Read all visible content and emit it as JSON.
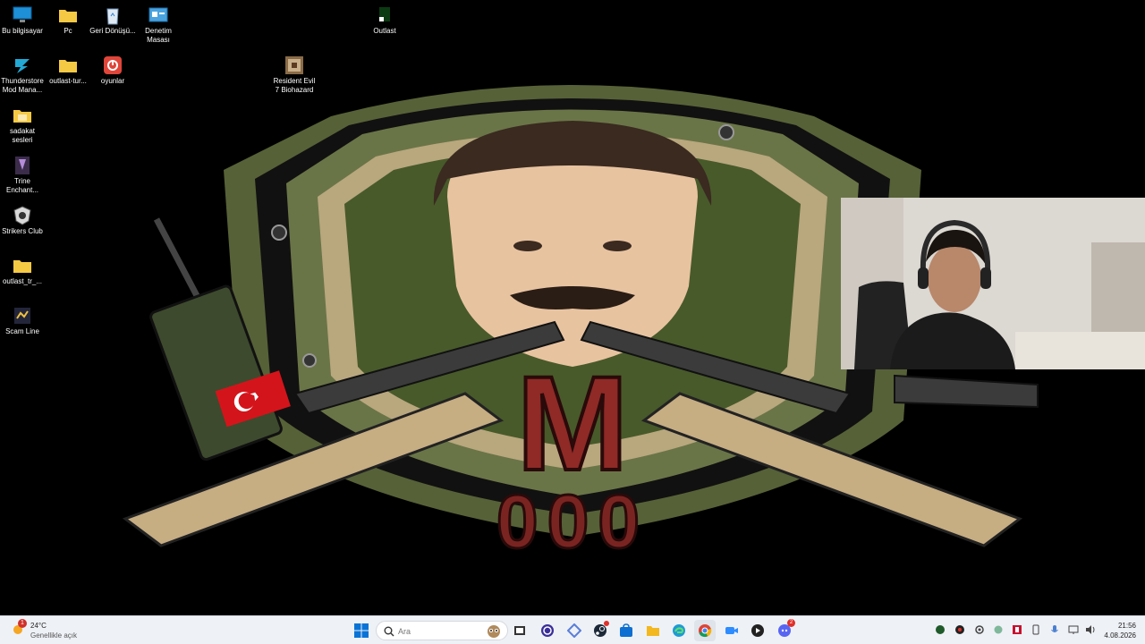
{
  "desktop": {
    "icons": [
      {
        "label": "Bu bilgisayar",
        "icon": "monitor-icon"
      },
      {
        "label": "Pc",
        "icon": "folder-icon"
      },
      {
        "label": "Geri Dönüşü...",
        "icon": "recycle-bin-icon"
      },
      {
        "label": "Denetim Masası",
        "icon": "control-panel-icon"
      },
      {
        "label": "Outlast",
        "icon": "outlast-shortcut-icon"
      },
      {
        "label": "Thunderstore Mod Mana...",
        "icon": "thunderstore-icon"
      },
      {
        "label": "outlast-tur...",
        "icon": "folder-icon"
      },
      {
        "label": "oyunlar",
        "icon": "power-app-icon"
      },
      {
        "label": "Resident Evil 7 Biohazard",
        "icon": "resident-evil-icon"
      },
      {
        "label": "sadakat sesleri",
        "icon": "folder-icon"
      },
      {
        "label": "Trine Enchant...",
        "icon": "trine-icon"
      },
      {
        "label": "Strikers Club",
        "icon": "strikers-club-icon"
      },
      {
        "label": "outlast_tr_...",
        "icon": "folder-icon"
      },
      {
        "label": "Scam Line",
        "icon": "scam-line-icon"
      }
    ]
  },
  "wallpaper": {
    "logo_letter": "M",
    "logo_number": "000",
    "flag": "turkey-flag"
  },
  "taskbar": {
    "weather": {
      "badge": "1",
      "temperature": "24°C",
      "condition": "Genellikle açık"
    },
    "search": {
      "placeholder": "Ara"
    },
    "apps": [
      "windows-start-icon",
      "task-view-icon",
      "browser-circle-icon",
      "diamond-app-icon",
      "steam-icon",
      "store-icon",
      "file-explorer-icon",
      "edge-icon",
      "chrome-icon",
      "zoom-video-icon",
      "media-player-icon",
      "discord-icon"
    ],
    "discord_badge": "2",
    "tray": [
      "tray-app-1-icon",
      "tray-app-2-icon",
      "tray-settings-icon",
      "tray-green-dot-icon",
      "tray-app-red-icon",
      "tray-phone-icon",
      "microphone-icon",
      "display-icon",
      "volume-icon"
    ],
    "clock": {
      "time": "21:56",
      "date": "4.08.2026"
    }
  },
  "colors": {
    "taskbar_bg": "#eef1f6",
    "desktop_bg": "#000000",
    "accent": "#0067c0"
  }
}
